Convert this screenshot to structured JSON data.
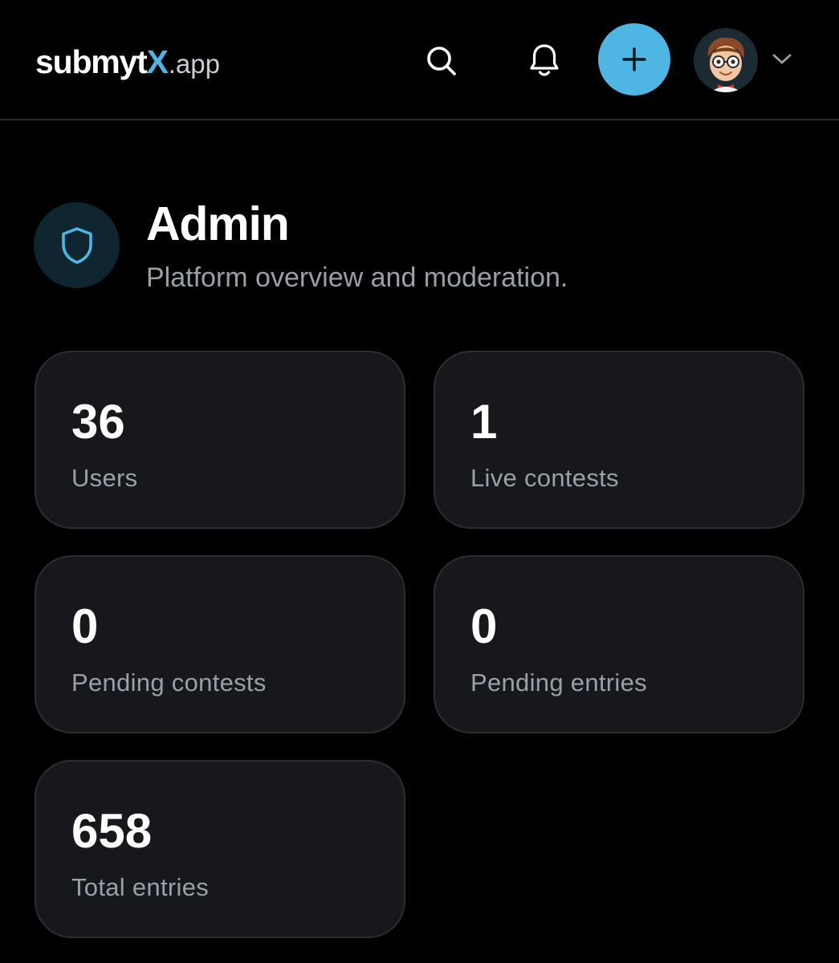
{
  "header": {
    "logo": {
      "brand": "submyt",
      "brand_accent": "X",
      "tld": ".app"
    },
    "icons": {
      "search": "search-icon",
      "notifications": "bell-icon",
      "create": "plus-icon",
      "avatar": "user-avatar",
      "menu": "chevron-down-icon"
    }
  },
  "page": {
    "icon": "shield-icon",
    "title": "Admin",
    "subtitle": "Platform overview and moderation."
  },
  "stats": [
    {
      "value": "36",
      "label": "Users"
    },
    {
      "value": "1",
      "label": "Live contests"
    },
    {
      "value": "0",
      "label": "Pending contests"
    },
    {
      "value": "0",
      "label": "Pending entries"
    },
    {
      "value": "658",
      "label": "Total entries"
    }
  ],
  "colors": {
    "background": "#000000",
    "accent": "#4fb6e3",
    "card_background": "#17181c",
    "card_border": "#2b2d33",
    "muted_text": "#9aa0aa"
  }
}
